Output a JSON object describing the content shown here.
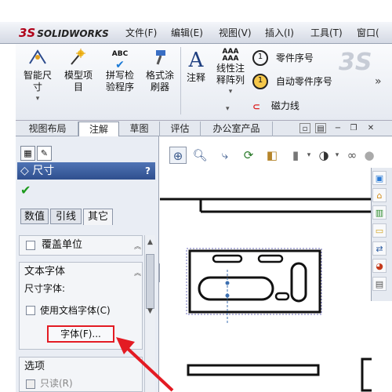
{
  "app": {
    "logo_ds": "3S",
    "logo_text": "SOLIDWORKS"
  },
  "menu": [
    "文件(F)",
    "编辑(E)",
    "视图(V)",
    "插入(I)",
    "工具(T)",
    "窗口("
  ],
  "ribbon": {
    "smart_dim": [
      "智能尺",
      "寸"
    ],
    "model_items": [
      "模型项",
      "目"
    ],
    "spell_check": {
      "icon_text": "ABC",
      "lines": [
        "拼写检",
        "验程序"
      ]
    },
    "format_painter": [
      "格式涂",
      "刷器"
    ],
    "note": {
      "icon_text": "A",
      "label": "注释"
    },
    "linear_note": {
      "icon_text": "AAA",
      "lines": [
        "线性注",
        "释阵列"
      ]
    },
    "balloon": "零件序号",
    "auto_balloon": "自动零件序号",
    "magnetic_line": "磁力线",
    "overflow": "»"
  },
  "tabs": [
    "视图布局",
    "注解",
    "草图",
    "评估",
    "办公室产品"
  ],
  "tabs_active": "注解",
  "property_manager": {
    "title": "尺寸",
    "help": "?",
    "ok_icon": "checkmark-icon",
    "tabs": [
      "数值",
      "引线",
      "其它"
    ],
    "active_tab": "其它",
    "override_units": "覆盖单位",
    "text_font_title": "文本字体",
    "dim_font_label": "尺寸字体:",
    "use_doc_font": "使用文档字体(C)",
    "font_button": "字体(F)...",
    "options_title": "选项",
    "read_only": "只读(R)"
  },
  "colors": {
    "highlight_red": "#e31b23",
    "header_blue": "#3a5fa0"
  }
}
